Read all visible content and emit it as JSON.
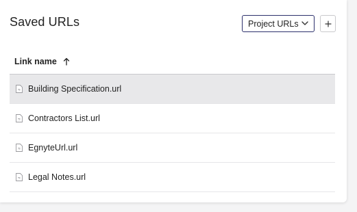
{
  "header": {
    "title": "Saved URLs",
    "dropdown_value": "Project URLs",
    "add_label": "+"
  },
  "table": {
    "column_header": "Link name",
    "sort": "ascending",
    "rows": [
      {
        "name": "Building Specification.url",
        "selected": true
      },
      {
        "name": "Contractors List.url",
        "selected": false
      },
      {
        "name": "EgnyteUrl.url",
        "selected": false
      },
      {
        "name": "Legal Notes.url",
        "selected": false
      }
    ]
  },
  "icons": {
    "dropdown": "chevron-down-icon",
    "sort": "arrow-up-icon",
    "file": "url-file-icon"
  },
  "colors": {
    "dropdown_border": "#2b2f6b",
    "selected_row": "#e8e8ea",
    "text": "#222222"
  }
}
